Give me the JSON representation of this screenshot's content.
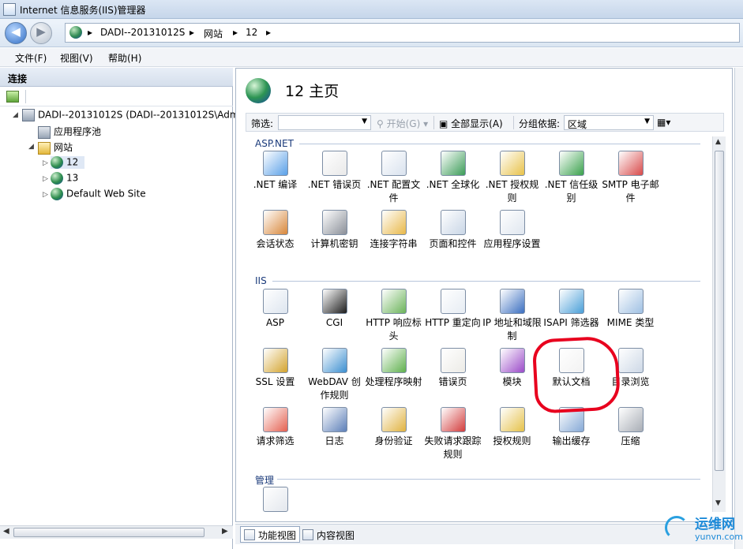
{
  "window": {
    "title": "Internet 信息服务(IIS)管理器"
  },
  "address": {
    "crumbs": [
      "DADI--20131012S",
      "网站",
      "12"
    ],
    "sep": "▸"
  },
  "menu": {
    "file": "文件(F)",
    "view": "视图(V)",
    "help": "帮助(H)"
  },
  "connections": {
    "title": "连接",
    "tree": {
      "server": "DADI--20131012S (DADI--20131012S\\Adm",
      "apppools": "应用程序池",
      "sites": "网站",
      "site12": "12",
      "site13": "13",
      "default_site": "Default Web Site"
    }
  },
  "page": {
    "title": "12 主页",
    "filter": {
      "label": "筛选:",
      "start": "开始(G)",
      "showall": "全部显示(A)",
      "groupby_label": "分组依据:",
      "groupby_value": "区域"
    },
    "groups": {
      "aspnet": "ASP.NET",
      "iis": "IIS",
      "mgmt": "管理"
    },
    "aspnet_items": [
      {
        "label": ".NET 编译",
        "color": "#5aa0e8"
      },
      {
        "label": ".NET 错误页",
        "color": "#e9e9e9"
      },
      {
        "label": ".NET 配置文件",
        "color": "#d9e2ee"
      },
      {
        "label": ".NET 全球化",
        "color": "#3c9c58"
      },
      {
        "label": ".NET 授权规则",
        "color": "#e8c24a"
      },
      {
        "label": ".NET 信任级别",
        "color": "#3aa14c"
      },
      {
        "label": "SMTP 电子邮件",
        "color": "#d84a4a"
      },
      {
        "label": "会话状态",
        "color": "#d8873a"
      },
      {
        "label": "计算机密钥",
        "color": "#8a8f98"
      },
      {
        "label": "连接字符串",
        "color": "#e8b84a"
      },
      {
        "label": "页面和控件",
        "color": "#c9d6e6"
      },
      {
        "label": "应用程序设置",
        "color": "#dfe6ef"
      }
    ],
    "iis_items": [
      {
        "label": "ASP",
        "color": "#dde5ef"
      },
      {
        "label": "CGI",
        "color": "#1c1c1c"
      },
      {
        "label": "HTTP 响应标头",
        "color": "#6bb35a"
      },
      {
        "label": "HTTP 重定向",
        "color": "#e6ecf3"
      },
      {
        "label": "IP 地址和域限制",
        "color": "#3b6fc0"
      },
      {
        "label": "ISAPI 筛选器",
        "color": "#4a9fd8"
      },
      {
        "label": "MIME 类型",
        "color": "#9fc0e3"
      },
      {
        "label": "SSL 设置",
        "color": "#d3a32e"
      },
      {
        "label": "WebDAV 创作规则",
        "color": "#3c8fd0"
      },
      {
        "label": "处理程序映射",
        "color": "#5fb04d"
      },
      {
        "label": "错误页",
        "color": "#ecebe6"
      },
      {
        "label": "模块",
        "color": "#9b4bc8"
      },
      {
        "label": "默认文档",
        "color": "#f2f2f2"
      },
      {
        "label": "目录浏览",
        "color": "#cdd8e6"
      },
      {
        "label": "请求筛选",
        "color": "#e46050"
      },
      {
        "label": "日志",
        "color": "#5c7fb8"
      },
      {
        "label": "身份验证",
        "color": "#e0b240"
      },
      {
        "label": "失败请求跟踪规则",
        "color": "#d23c3c"
      },
      {
        "label": "授权规则",
        "color": "#e5c14a"
      },
      {
        "label": "输出缓存",
        "color": "#86a9d6"
      },
      {
        "label": "压缩",
        "color": "#a8adb5"
      }
    ],
    "mgmt_items": [
      {
        "label": "",
        "color": "#e3e7ed"
      }
    ]
  },
  "tabs": {
    "features": "功能视图",
    "content": "内容视图"
  },
  "watermark": {
    "site_cn": "运维网",
    "site_url": "yunvn.com"
  }
}
